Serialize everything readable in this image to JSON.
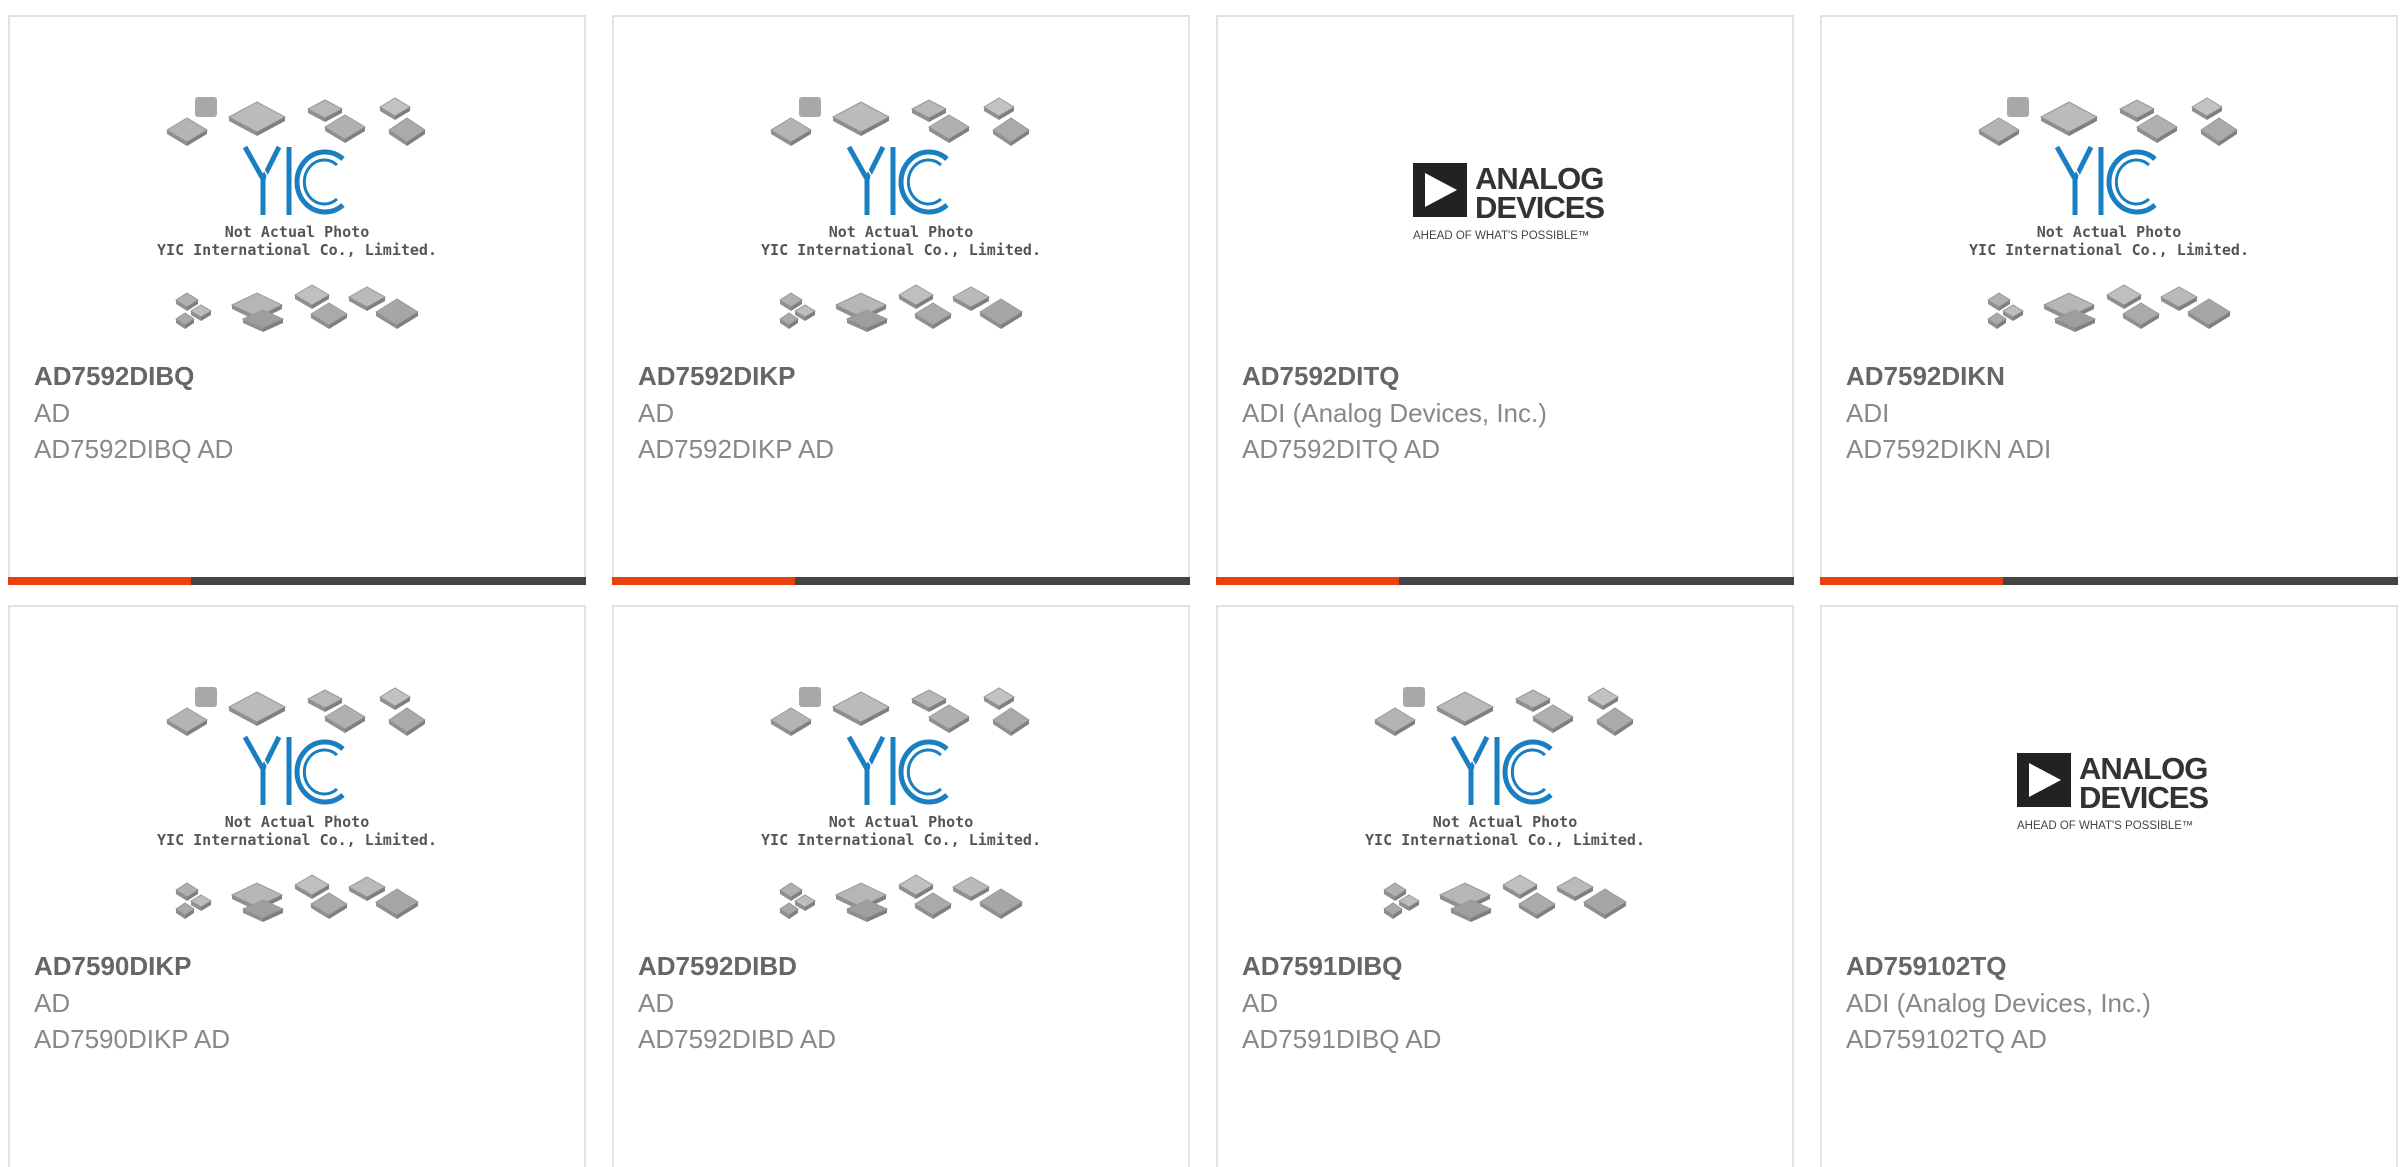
{
  "placeholder": {
    "brand": "YIC",
    "line1": "Not Actual Photo",
    "line2": "YIC International Co., Limited."
  },
  "adi_logo": {
    "line1": "ANALOG",
    "line2": "DEVICES",
    "tagline": "AHEAD OF WHAT'S POSSIBLE™"
  },
  "colors": {
    "accent": "#e8400f",
    "bar": "#444444",
    "yic_blue": "#1a7fc1"
  },
  "products": [
    {
      "part": "AD7592DIBQ",
      "manufacturer": "AD",
      "description": "AD7592DIBQ AD",
      "image": "yic-placeholder"
    },
    {
      "part": "AD7592DIKP",
      "manufacturer": "AD",
      "description": "AD7592DIKP AD",
      "image": "yic-placeholder"
    },
    {
      "part": "AD7592DITQ",
      "manufacturer": "ADI (Analog Devices, Inc.)",
      "description": "AD7592DITQ AD",
      "image": "adi-logo"
    },
    {
      "part": "AD7592DIKN",
      "manufacturer": "ADI",
      "description": "AD7592DIKN ADI",
      "image": "yic-placeholder"
    },
    {
      "part": "AD7590DIKP",
      "manufacturer": "AD",
      "description": "AD7590DIKP AD",
      "image": "yic-placeholder"
    },
    {
      "part": "AD7592DIBD",
      "manufacturer": "AD",
      "description": "AD7592DIBD AD",
      "image": "yic-placeholder"
    },
    {
      "part": "AD7591DIBQ",
      "manufacturer": "AD",
      "description": "AD7591DIBQ AD",
      "image": "yic-placeholder"
    },
    {
      "part": "AD759102TQ",
      "manufacturer": "ADI (Analog Devices, Inc.)",
      "description": "AD759102TQ AD",
      "image": "adi-logo"
    }
  ]
}
